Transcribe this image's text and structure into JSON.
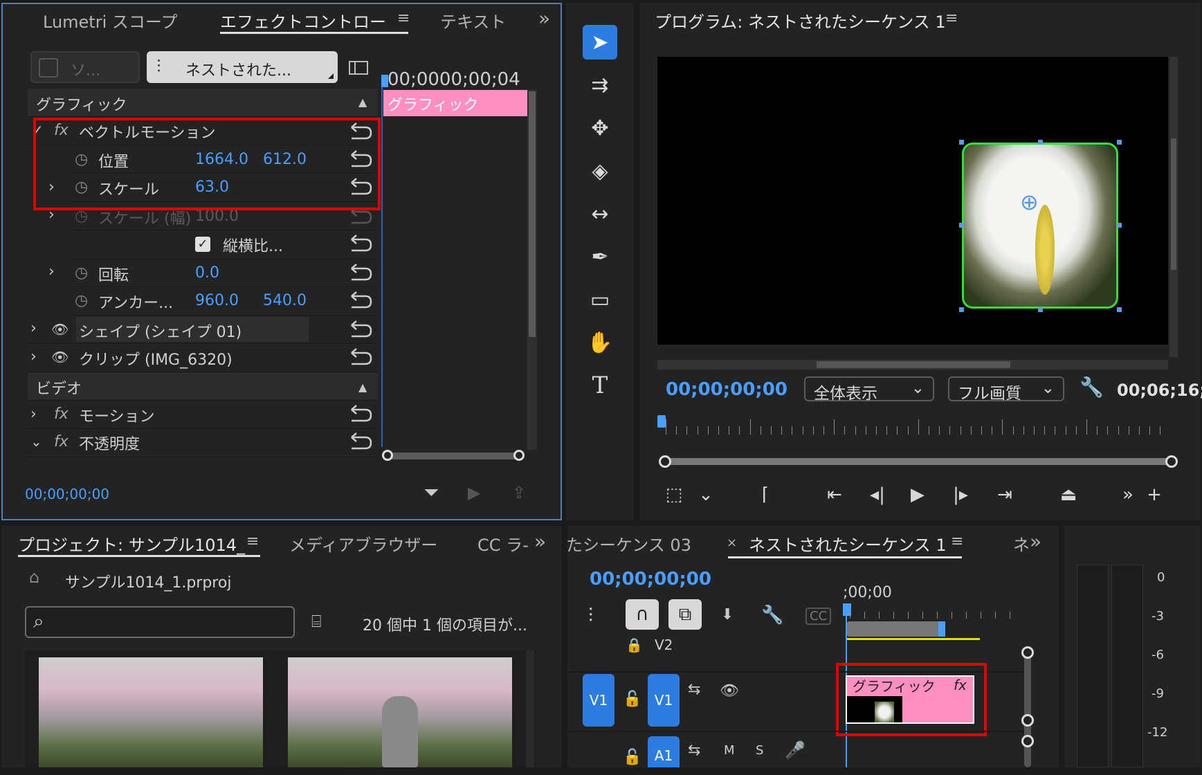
{
  "effects_panel": {
    "tabs": [
      "Lumetri スコープ",
      "エフェクトコントロー",
      "テキスト"
    ],
    "more": "»",
    "source_btn": "ソ...",
    "seq_btn": "ネストされた...",
    "timecode": "00;0000;00;04",
    "clip_label": "グラフィック",
    "sections": {
      "graphic": "グラフィック",
      "video": "ビデオ"
    },
    "vector_motion": "ベクトルモーション",
    "position_label": "位置",
    "position_x": "1664.0",
    "position_y": "612.0",
    "scale_label": "スケール",
    "scale_value": "63.0",
    "scale_width_label": "スケール (幅)",
    "scale_width_value": "100.0",
    "aspect_label": "縦横比...",
    "rotation_label": "回転",
    "rotation_value": "0.0",
    "anchor_label": "アンカー...",
    "anchor_x": "960.0",
    "anchor_y": "540.0",
    "shape_label": "シェイプ (シェイプ 01)",
    "clip_item": "クリップ (IMG_6320)",
    "motion_label": "モーション",
    "opacity_label": "不透明度",
    "footer_time": "00;00;00;00",
    "fx": "fx"
  },
  "tools": {
    "type_tool": "T"
  },
  "program_panel": {
    "title": "プログラム: ネストされたシーケンス 1",
    "timecode": "00;00;00;00",
    "zoom": "全体表示",
    "quality": "フル画質",
    "duration": "00;06;16;"
  },
  "project_panel": {
    "tabs": [
      "プロジェクト: サンプル1014_",
      "メディアブラウザー",
      "CC ラ-"
    ],
    "file": "サンプル1014_1.prproj",
    "search_placeholder": "",
    "item_count": "20 個中 1 個の項目が..."
  },
  "timeline_panel": {
    "tabs": [
      "たシーケンス 03",
      "ネストされたシーケンス 1",
      "ネ"
    ],
    "close": "×",
    "timecode": "00;00;00;00",
    "ruler_label": ";00;00",
    "v2": "V2",
    "v1": "V1",
    "a1": "A1",
    "m": "M",
    "s": "S",
    "clip_label": "グラフィック",
    "cc": "CC"
  },
  "meter": {
    "labels": [
      "0",
      "-3",
      "-6",
      "-9",
      "-12"
    ]
  }
}
